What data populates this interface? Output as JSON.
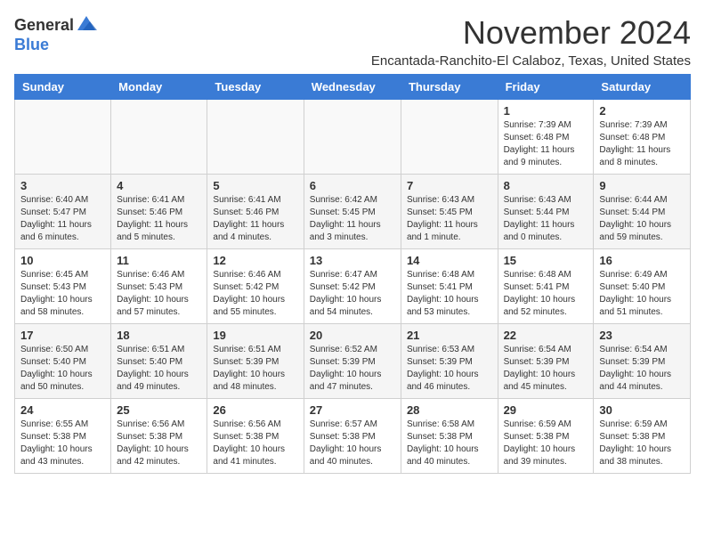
{
  "logo": {
    "general": "General",
    "blue": "Blue"
  },
  "title": "November 2024",
  "subtitle": "Encantada-Ranchito-El Calaboz, Texas, United States",
  "headers": [
    "Sunday",
    "Monday",
    "Tuesday",
    "Wednesday",
    "Thursday",
    "Friday",
    "Saturday"
  ],
  "weeks": [
    [
      {
        "day": "",
        "info": ""
      },
      {
        "day": "",
        "info": ""
      },
      {
        "day": "",
        "info": ""
      },
      {
        "day": "",
        "info": ""
      },
      {
        "day": "",
        "info": ""
      },
      {
        "day": "1",
        "info": "Sunrise: 7:39 AM\nSunset: 6:48 PM\nDaylight: 11 hours and 9 minutes."
      },
      {
        "day": "2",
        "info": "Sunrise: 7:39 AM\nSunset: 6:48 PM\nDaylight: 11 hours and 8 minutes."
      }
    ],
    [
      {
        "day": "3",
        "info": "Sunrise: 6:40 AM\nSunset: 5:47 PM\nDaylight: 11 hours and 6 minutes."
      },
      {
        "day": "4",
        "info": "Sunrise: 6:41 AM\nSunset: 5:46 PM\nDaylight: 11 hours and 5 minutes."
      },
      {
        "day": "5",
        "info": "Sunrise: 6:41 AM\nSunset: 5:46 PM\nDaylight: 11 hours and 4 minutes."
      },
      {
        "day": "6",
        "info": "Sunrise: 6:42 AM\nSunset: 5:45 PM\nDaylight: 11 hours and 3 minutes."
      },
      {
        "day": "7",
        "info": "Sunrise: 6:43 AM\nSunset: 5:45 PM\nDaylight: 11 hours and 1 minute."
      },
      {
        "day": "8",
        "info": "Sunrise: 6:43 AM\nSunset: 5:44 PM\nDaylight: 11 hours and 0 minutes."
      },
      {
        "day": "9",
        "info": "Sunrise: 6:44 AM\nSunset: 5:44 PM\nDaylight: 10 hours and 59 minutes."
      }
    ],
    [
      {
        "day": "10",
        "info": "Sunrise: 6:45 AM\nSunset: 5:43 PM\nDaylight: 10 hours and 58 minutes."
      },
      {
        "day": "11",
        "info": "Sunrise: 6:46 AM\nSunset: 5:43 PM\nDaylight: 10 hours and 57 minutes."
      },
      {
        "day": "12",
        "info": "Sunrise: 6:46 AM\nSunset: 5:42 PM\nDaylight: 10 hours and 55 minutes."
      },
      {
        "day": "13",
        "info": "Sunrise: 6:47 AM\nSunset: 5:42 PM\nDaylight: 10 hours and 54 minutes."
      },
      {
        "day": "14",
        "info": "Sunrise: 6:48 AM\nSunset: 5:41 PM\nDaylight: 10 hours and 53 minutes."
      },
      {
        "day": "15",
        "info": "Sunrise: 6:48 AM\nSunset: 5:41 PM\nDaylight: 10 hours and 52 minutes."
      },
      {
        "day": "16",
        "info": "Sunrise: 6:49 AM\nSunset: 5:40 PM\nDaylight: 10 hours and 51 minutes."
      }
    ],
    [
      {
        "day": "17",
        "info": "Sunrise: 6:50 AM\nSunset: 5:40 PM\nDaylight: 10 hours and 50 minutes."
      },
      {
        "day": "18",
        "info": "Sunrise: 6:51 AM\nSunset: 5:40 PM\nDaylight: 10 hours and 49 minutes."
      },
      {
        "day": "19",
        "info": "Sunrise: 6:51 AM\nSunset: 5:39 PM\nDaylight: 10 hours and 48 minutes."
      },
      {
        "day": "20",
        "info": "Sunrise: 6:52 AM\nSunset: 5:39 PM\nDaylight: 10 hours and 47 minutes."
      },
      {
        "day": "21",
        "info": "Sunrise: 6:53 AM\nSunset: 5:39 PM\nDaylight: 10 hours and 46 minutes."
      },
      {
        "day": "22",
        "info": "Sunrise: 6:54 AM\nSunset: 5:39 PM\nDaylight: 10 hours and 45 minutes."
      },
      {
        "day": "23",
        "info": "Sunrise: 6:54 AM\nSunset: 5:39 PM\nDaylight: 10 hours and 44 minutes."
      }
    ],
    [
      {
        "day": "24",
        "info": "Sunrise: 6:55 AM\nSunset: 5:38 PM\nDaylight: 10 hours and 43 minutes."
      },
      {
        "day": "25",
        "info": "Sunrise: 6:56 AM\nSunset: 5:38 PM\nDaylight: 10 hours and 42 minutes."
      },
      {
        "day": "26",
        "info": "Sunrise: 6:56 AM\nSunset: 5:38 PM\nDaylight: 10 hours and 41 minutes."
      },
      {
        "day": "27",
        "info": "Sunrise: 6:57 AM\nSunset: 5:38 PM\nDaylight: 10 hours and 40 minutes."
      },
      {
        "day": "28",
        "info": "Sunrise: 6:58 AM\nSunset: 5:38 PM\nDaylight: 10 hours and 40 minutes."
      },
      {
        "day": "29",
        "info": "Sunrise: 6:59 AM\nSunset: 5:38 PM\nDaylight: 10 hours and 39 minutes."
      },
      {
        "day": "30",
        "info": "Sunrise: 6:59 AM\nSunset: 5:38 PM\nDaylight: 10 hours and 38 minutes."
      }
    ]
  ]
}
